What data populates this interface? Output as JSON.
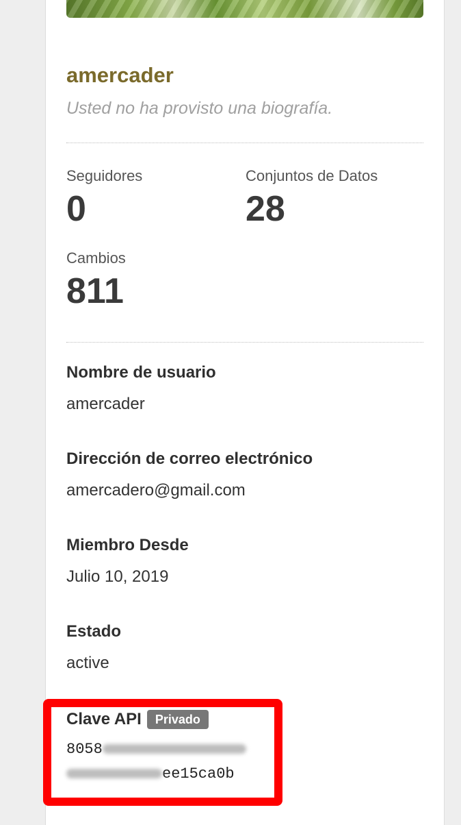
{
  "profile": {
    "username_heading": "amercader",
    "bio": "Usted no ha provisto una biografía."
  },
  "stats": {
    "followers_label": "Seguidores",
    "followers_value": "0",
    "datasets_label": "Conjuntos de Datos",
    "datasets_value": "28",
    "edits_label": "Cambios",
    "edits_value": "811"
  },
  "info": {
    "username_label": "Nombre de usuario",
    "username_value": "amercader",
    "email_label": "Dirección de correo electrónico",
    "email_value": "amercadero@gmail.com",
    "member_since_label": "Miembro Desde",
    "member_since_value": "Julio 10, 2019",
    "state_label": "Estado",
    "state_value": "active"
  },
  "api": {
    "label": "Clave API",
    "badge": "Privado",
    "key_prefix": "8058",
    "key_suffix": "ee15ca0b"
  },
  "colors": {
    "username": "#7a6a2b",
    "highlight": "#ff0000",
    "badge": "#777777"
  }
}
